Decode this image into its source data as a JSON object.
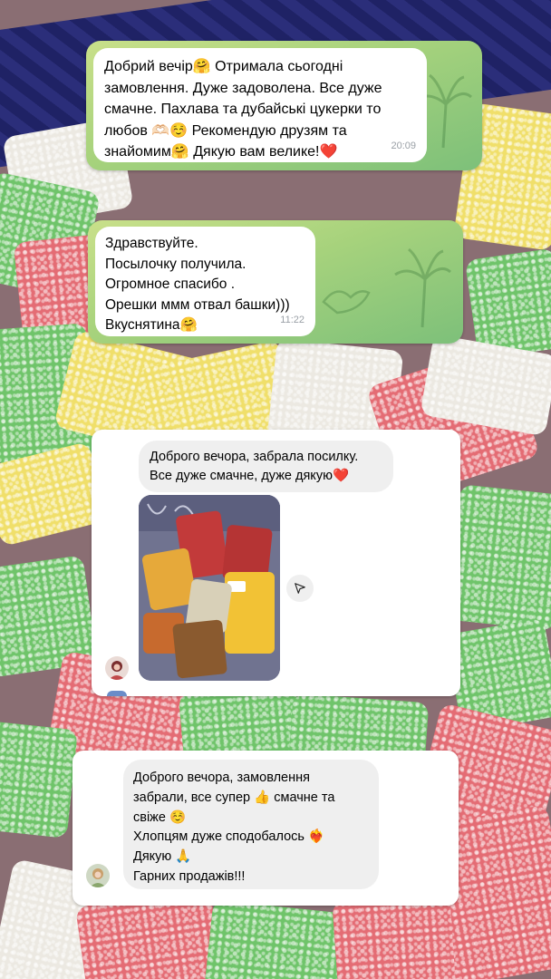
{
  "reviews": {
    "tg1": {
      "text": "Добрий вечір🤗 Отримала сьогодні\nзамовлення. Дуже задоволена. Все дуже\nсмачне. Пахлава та дубайські цукерки то\nлюбов 🫶🏻☺️ Рекомендую друзям та\nзнайомим🤗 Дякую вам велике!❤️",
      "time": "20:09"
    },
    "tg2": {
      "text": "Здравствуйте.\nПосылочку получила.\nОгромное спасибо .\nОрешки ммм отвал башки)))\nВкуснятина🤗",
      "time": "11:22"
    },
    "ig1": {
      "text": "Доброго вечора, забрала  посилку.\nВсе дуже смачне, дуже дякую❤️"
    },
    "ig2": {
      "text": "Доброго вечора, замовлення\nзабрали, все супер 👍 смачне та\nсвіже ☺️\nХлопцям дуже сподобалось ❤️‍🔥\nДякую 🙏\nГарних продажів!!!"
    }
  },
  "icons": {
    "share": "send-icon",
    "avatar": "user-avatar"
  },
  "colors": {
    "telegram_card": "#a6d27c",
    "bubble": "#ffffff",
    "instagram_bubble": "#efefef",
    "timestamp": "#9aa0a6"
  }
}
